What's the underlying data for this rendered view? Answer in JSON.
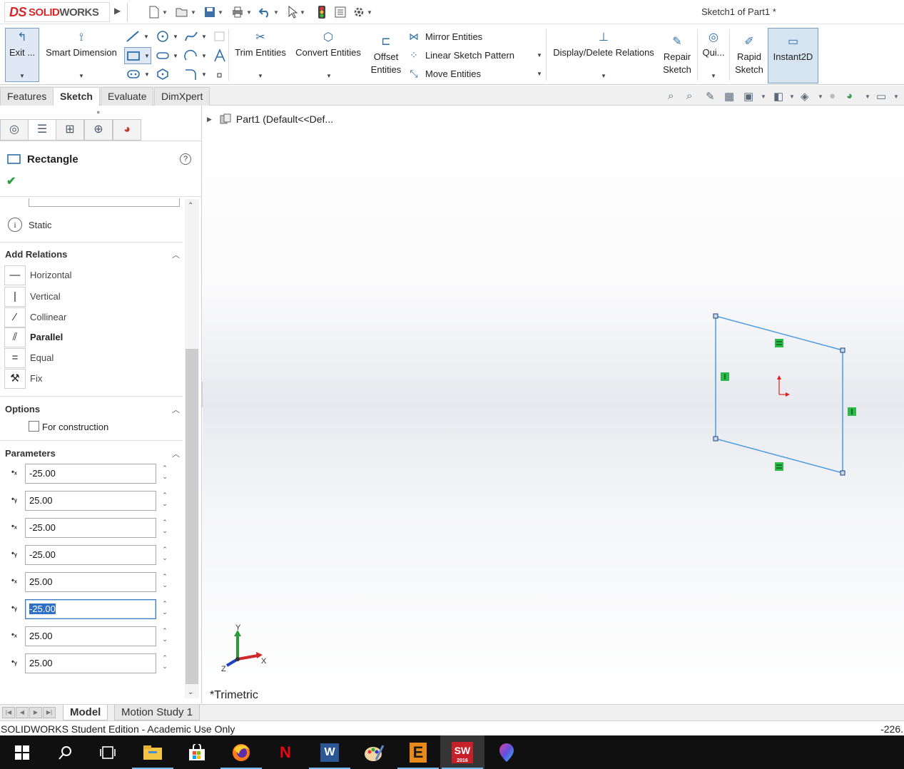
{
  "window": {
    "title": "Sketch1 of Part1 *",
    "brand_ds": "DS",
    "brand_solid": "SOLID",
    "brand_works": "WORKS"
  },
  "ribbon": {
    "exit_sketch": "Exit ...",
    "smart_dimension": "Smart Dimension",
    "trim_entities": "Trim Entities",
    "convert_entities": "Convert Entities",
    "offset_entities_1": "Offset",
    "offset_entities_2": "Entities",
    "mirror_entities": "Mirror Entities",
    "linear_sketch_pattern": "Linear Sketch Pattern",
    "move_entities": "Move Entities",
    "display_delete_relations": "Display/Delete Relations",
    "repair_sketch_1": "Repair",
    "repair_sketch_2": "Sketch",
    "quick_snaps": "Qui...",
    "rapid_sketch_1": "Rapid",
    "rapid_sketch_2": "Sketch",
    "instant2d": "Instant2D"
  },
  "command_tabs": [
    "Features",
    "Sketch",
    "Evaluate",
    "DimXpert"
  ],
  "active_command_tab": "Sketch",
  "property_manager": {
    "title": "Rectangle",
    "help": "?",
    "status": "Static",
    "add_relations": {
      "title": "Add Relations",
      "items": [
        "Horizontal",
        "Vertical",
        "Collinear",
        "Parallel",
        "Equal",
        "Fix"
      ],
      "bold_item": "Parallel"
    },
    "options": {
      "title": "Options",
      "for_construction": "For construction",
      "for_construction_checked": false
    },
    "parameters": {
      "title": "Parameters",
      "fields": [
        {
          "axis": "x",
          "value": "-25.00"
        },
        {
          "axis": "Y",
          "value": "25.00"
        },
        {
          "axis": "x",
          "value": "-25.00"
        },
        {
          "axis": "Y",
          "value": "-25.00"
        },
        {
          "axis": "x",
          "value": "25.00"
        },
        {
          "axis": "Y",
          "value": "-25.00",
          "focused": true
        },
        {
          "axis": "x",
          "value": "25.00"
        },
        {
          "axis": "Y",
          "value": "25.00"
        }
      ]
    }
  },
  "feature_tree": {
    "root": "Part1  (Default<<Def..."
  },
  "viewport": {
    "view_orientation": "*Trimetric",
    "triad": {
      "x": "X",
      "y": "Y",
      "z": "Z"
    },
    "sketch_color": "#4a9be0",
    "relation_color": "#2db84a"
  },
  "bottom_tabs": [
    "Model",
    "Motion Study 1"
  ],
  "status_bar": {
    "text": "SOLIDWORKS Student Edition - Academic Use Only",
    "coordinate": "-226."
  },
  "taskbar": {
    "items": [
      "start-icon",
      "search-icon",
      "task-view-icon",
      "file-explorer-icon",
      "store-icon",
      "firefox-icon",
      "netflix-icon",
      "word-icon",
      "paint-icon",
      "e-app-icon",
      "solidworks-icon",
      "balloon-app-icon"
    ],
    "solidworks_year": "2016",
    "solidworks_label": "SW",
    "netflix_label": "N",
    "word_label": "W",
    "e_label": "E"
  }
}
